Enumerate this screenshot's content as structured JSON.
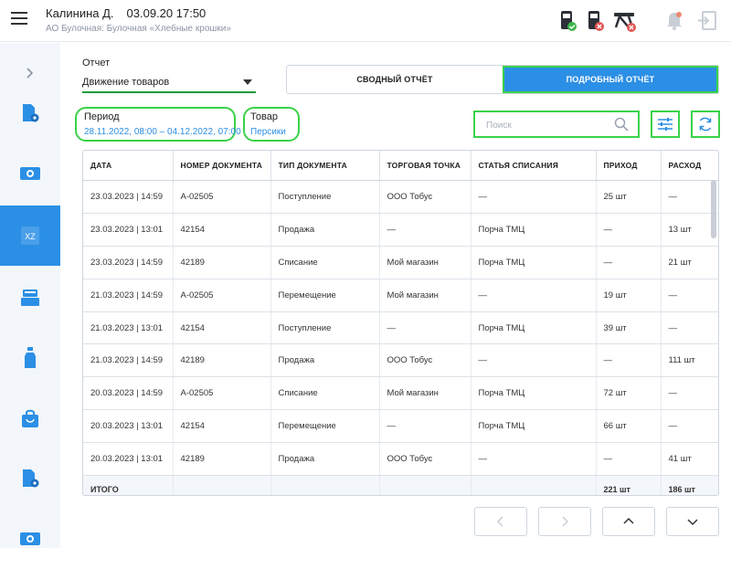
{
  "header": {
    "user_name": "Калинина Д.",
    "datetime": "03.09.20 17:50",
    "organization": "АО Булочная: Булочная «Хлебные крошки»",
    "icons": [
      "menu-icon",
      "terminal-ok-icon",
      "terminal-error-icon",
      "scanner-error-icon",
      "bell-icon",
      "logout-icon"
    ],
    "status_colors": {
      "ok": "#3ab54a",
      "error": "#e25555",
      "muted": "#c9ced6"
    }
  },
  "sidebar": {
    "items": [
      {
        "icon": "chevron-right-icon",
        "label": ""
      },
      {
        "icon": "document-settings-icon",
        "label": ""
      },
      {
        "icon": "money-icon",
        "label": ""
      },
      {
        "icon": "xz-report-icon",
        "label": "XZ",
        "active": true
      },
      {
        "icon": "cash-register-icon",
        "label": ""
      },
      {
        "icon": "bottle-icon",
        "label": ""
      },
      {
        "icon": "shopping-bag-icon",
        "label": ""
      },
      {
        "icon": "document-settings-icon",
        "label": ""
      },
      {
        "icon": "money-icon",
        "label": ""
      }
    ]
  },
  "report": {
    "label": "Отчет",
    "selected": "Движение товаров"
  },
  "tabs": {
    "summary": "СВОДНЫЙ ОТЧЁТ",
    "detailed": "ПОДРОБНЫЙ ОТЧЁТ",
    "active": "detailed"
  },
  "period": {
    "label": "Период",
    "value": "28.11.2022, 08:00 – 04.12.2022, 07:00"
  },
  "goods": {
    "label": "Товар",
    "value": "Персики"
  },
  "search": {
    "placeholder": "Поиск"
  },
  "table": {
    "columns": [
      "ДАТА",
      "НОМЕР ДОКУМЕНТА",
      "ТИП ДОКУМЕНТА",
      "ТОРГОВАЯ ТОЧКА",
      "СТАТЬЯ СПИСАНИЯ",
      "ПРИХОД",
      "РАСХОД"
    ],
    "rows": [
      [
        "23.03.2023 | 14:59",
        "А-02505",
        "Поступление",
        "ООО Тобус",
        "—",
        "25 шт",
        "—"
      ],
      [
        "23.03.2023 | 13:01",
        "42154",
        "Продажа",
        "—",
        "Порча ТМЦ",
        "—",
        "13 шт"
      ],
      [
        "23.03.2023 | 14:59",
        "42189",
        "Списание",
        "Мой магазин",
        "Порча ТМЦ",
        "—",
        "21 шт"
      ],
      [
        "21.03.2023 | 14:59",
        "А-02505",
        "Перемещение",
        "Мой магазин",
        "—",
        "19 шт",
        "—"
      ],
      [
        "21.03.2023 | 13:01",
        "42154",
        "Поступление",
        "—",
        "Порча ТМЦ",
        "39 шт",
        "—"
      ],
      [
        "21.03.2023 | 14:59",
        "42189",
        "Продажа",
        "ООО Тобус",
        "—",
        "—",
        "111 шт"
      ],
      [
        "20.03.2023 | 14:59",
        "А-02505",
        "Списание",
        "Мой магазин",
        "Порча ТМЦ",
        "72 шт",
        "—"
      ],
      [
        "20.03.2023 | 13:01",
        "42154",
        "Перемещение",
        "—",
        "Порча ТМЦ",
        "66 шт",
        "—"
      ],
      [
        "20.03.2023 | 13:01",
        "42189",
        "Продажа",
        "ООО Тобус",
        "—",
        "—",
        "41 шт"
      ]
    ],
    "total": {
      "label": "ИТОГО",
      "income": "221 шт",
      "expense": "186 шт"
    }
  },
  "pagination": {
    "buttons": [
      "chevron-left-icon",
      "chevron-right-icon",
      "chevron-up-icon",
      "chevron-down-icon"
    ]
  },
  "colors": {
    "accent": "#2b8fe5",
    "highlight": "#3ad24a",
    "underline": "#1c9a3a"
  }
}
